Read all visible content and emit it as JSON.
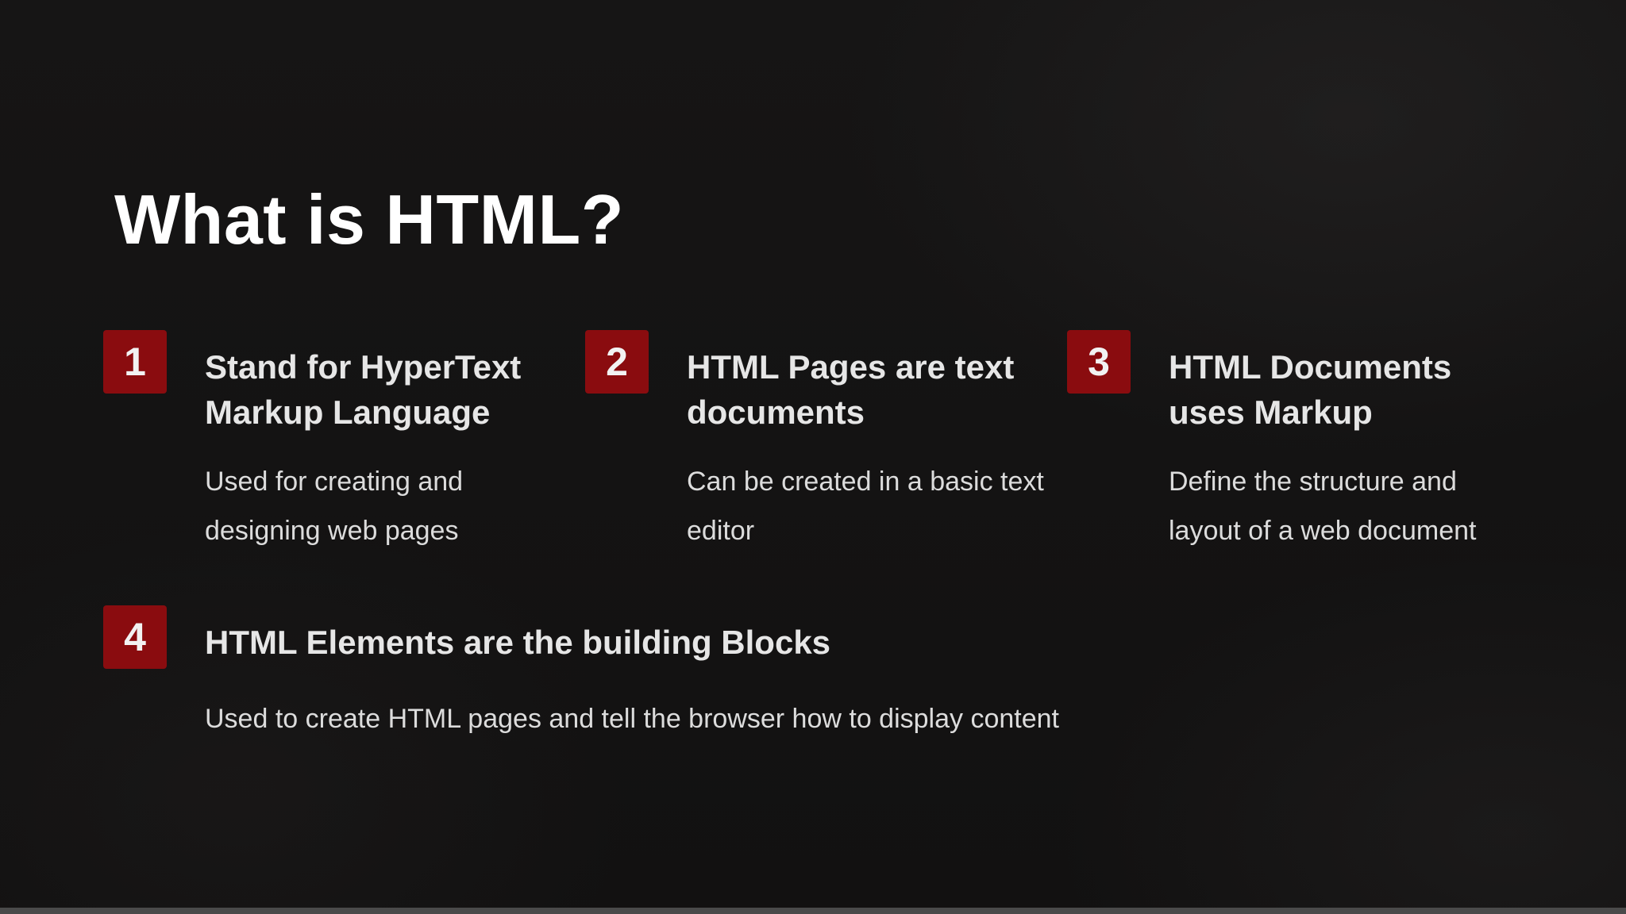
{
  "slide": {
    "title": "What is HTML?",
    "accent_color": "#8a0c0f",
    "cards": [
      {
        "number": "1",
        "heading": "Stand for HyperText Markup Language",
        "text": "Used for creating and designing web pages"
      },
      {
        "number": "2",
        "heading": "HTML Pages are text documents",
        "text": "Can be created in a basic text editor"
      },
      {
        "number": "3",
        "heading": "HTML Documents uses Markup",
        "text": "Define the structure and layout of a web document"
      },
      {
        "number": "4",
        "heading": "HTML Elements are the building Blocks",
        "text": "Used to create HTML pages and tell the browser how to display content"
      }
    ]
  }
}
